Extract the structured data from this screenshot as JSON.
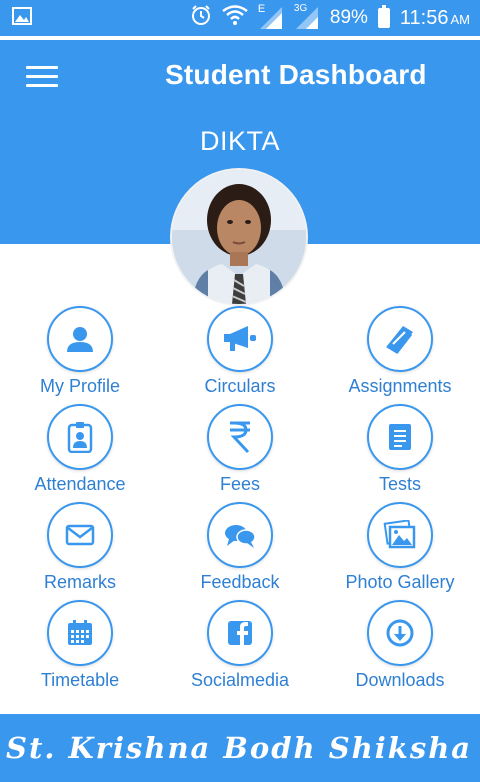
{
  "status_bar": {
    "battery": "89%",
    "time": "11:56",
    "time_suffix": "AM",
    "network_e": "E",
    "network_3g": "3G"
  },
  "header": {
    "title": "Student Dashboard",
    "student_name": "DIKTA"
  },
  "menu": [
    {
      "label": "My Profile",
      "icon": "profile-icon"
    },
    {
      "label": "Circulars",
      "icon": "megaphone-icon"
    },
    {
      "label": "Assignments",
      "icon": "book-icon"
    },
    {
      "label": "Attendance",
      "icon": "id-badge-icon"
    },
    {
      "label": "Fees",
      "icon": "rupee-icon"
    },
    {
      "label": "Tests",
      "icon": "document-icon"
    },
    {
      "label": "Remarks",
      "icon": "mail-icon"
    },
    {
      "label": "Feedback",
      "icon": "chat-icon"
    },
    {
      "label": "Photo Gallery",
      "icon": "photos-icon"
    },
    {
      "label": "Timetable",
      "icon": "calendar-icon"
    },
    {
      "label": "Socialmedia",
      "icon": "facebook-icon"
    },
    {
      "label": "Downloads",
      "icon": "download-icon"
    }
  ],
  "footer": {
    "school_name": "St. Krishna Bodh Shiksha S..."
  },
  "colors": {
    "primary": "#3a97ee",
    "label": "#2f7fd3"
  }
}
